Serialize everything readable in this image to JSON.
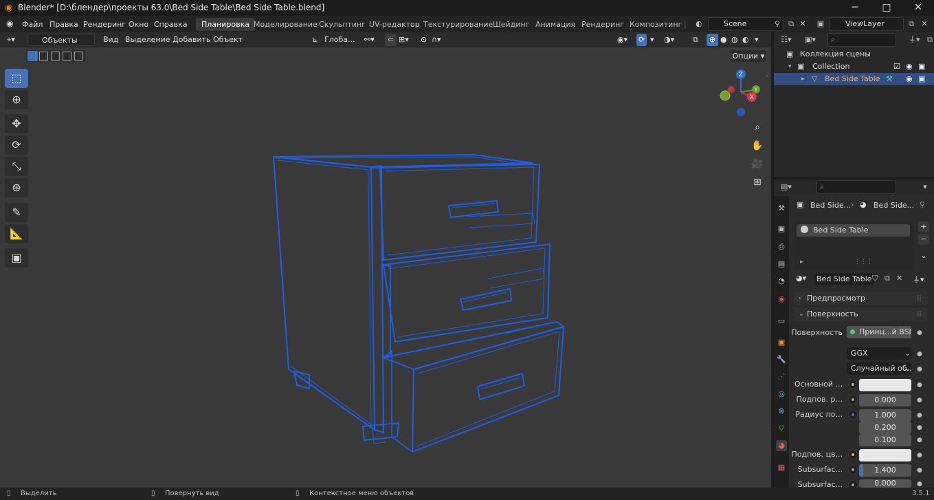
{
  "titlebar": {
    "title": "Blender* [D:\\блендер\\проекты 63.0\\Bed Side Table\\Bed Side Table.blend]",
    "minimize": "─",
    "maximize": "□",
    "close": "✕"
  },
  "menu": [
    "Файл",
    "Правка",
    "Рендеринг",
    "Окно",
    "Справка"
  ],
  "workspaces": [
    "Планировка",
    "Моделирование",
    "Скульптинг",
    "UV-редактор",
    "Текстурирование",
    "Шейдинг",
    "Анимация",
    "Рендеринг",
    "Композитинг"
  ],
  "scene": {
    "name": "Scene"
  },
  "viewlayer": {
    "name": "ViewLayer"
  },
  "viewport_header": {
    "mode": "Объекты",
    "items": [
      "Вид",
      "Выделение",
      "Добавить",
      "Объект"
    ],
    "transform_orientation": "Глоба...",
    "options": "Опции"
  },
  "gizmo": {
    "z": "Z",
    "y": "Y",
    "x": "X"
  },
  "outliner": {
    "search_placeholder": "",
    "scene_collection": "Коллекция сцены",
    "collection": "Collection",
    "object": "Bed Side Table"
  },
  "properties": {
    "breadcrumb_object": "Bed Side...",
    "breadcrumb_material": "Bed Side...",
    "slot_name": "Bed Side Table",
    "material_name": "Bed Side Table",
    "panel_preview": "Предпросмотр",
    "panel_surface": "Поверхность",
    "surface_label": "Поверхность",
    "surface_value": "Принц...й BSDF",
    "distribution": "GGX",
    "subsurface_method": "Случайный об...",
    "rows": [
      {
        "label": "Основной ...",
        "value": "",
        "kind": "color",
        "dot": "#c8b45a"
      },
      {
        "label": "Подпов. р...",
        "value": "0.000",
        "kind": "num",
        "dot": "#a0a0a0"
      },
      {
        "label": "Радиус по...",
        "value": "1.000",
        "kind": "num",
        "dot": "#6363c7"
      },
      {
        "label": "",
        "value": "0.200",
        "kind": "num",
        "dot": ""
      },
      {
        "label": "",
        "value": "0.100",
        "kind": "num",
        "dot": ""
      },
      {
        "label": "Подпов. цв...",
        "value": "",
        "kind": "color",
        "dot": "#c8b45a"
      },
      {
        "label": "Subsurfac...",
        "value": "1.400",
        "kind": "slider",
        "dot": "#a0a0a0"
      },
      {
        "label": "Subsurfac...",
        "value": "0.000",
        "kind": "num",
        "dot": "#a0a0a0"
      }
    ]
  },
  "statusbar": {
    "select": "Выделить",
    "rotate": "Повернуть вид",
    "context": "Контекстное меню объектов",
    "version": "3.5.1"
  },
  "colors": {
    "accent": "#4772b3",
    "wire": "#1f5ee6",
    "bg_viewport": "#393939",
    "selected_row": "#334d80"
  }
}
